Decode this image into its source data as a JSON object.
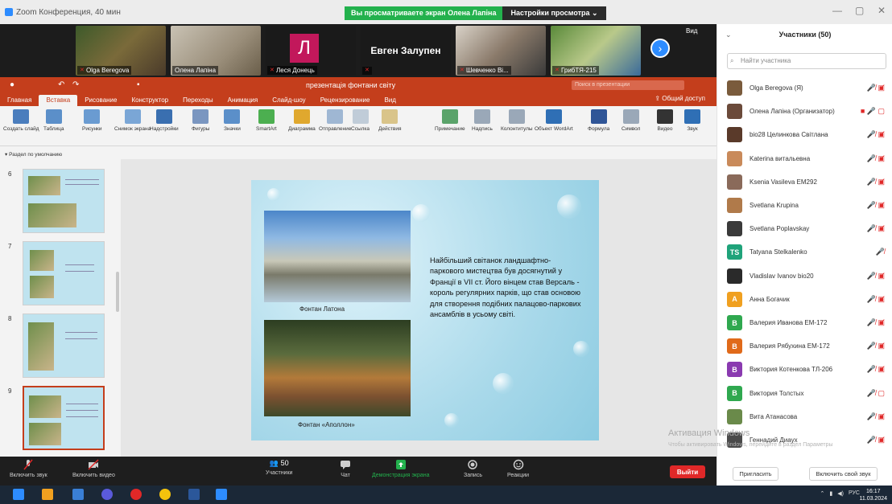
{
  "window": {
    "title": "Zoom Конференция, 40 мин"
  },
  "banner": {
    "viewing": "Вы просматриваете экран Олена Лапіна",
    "options": "Настройки просмотра ⌄"
  },
  "videos": [
    {
      "name": "Olga Beregova"
    },
    {
      "name": "Олена Лапіна"
    },
    {
      "name": "Леся Донець",
      "avatar": "Л"
    },
    {
      "name": "Евген Залупен"
    },
    {
      "name": "Шевченко Ві..."
    },
    {
      "name": "ГрибТЯ-215"
    }
  ],
  "view_label": "Вид",
  "ppt": {
    "doc_title": "презентація фонтани світу",
    "search_placeholder": "Поиск в презентации",
    "tabs": [
      "Главная",
      "Вставка",
      "Рисование",
      "Конструктор",
      "Переходы",
      "Анимация",
      "Слайд-шоу",
      "Рецензирование",
      "Вид"
    ],
    "active_tab": 1,
    "share": "Общий доступ",
    "ribbon": [
      {
        "label": "Создать слайд",
        "color": "#4a7dbd"
      },
      {
        "label": "Таблица",
        "color": "#5b8fc9"
      },
      {
        "label": "Рисунки",
        "color": "#6a9bd1"
      },
      {
        "label": "Снимок экрана",
        "color": "#7aa6d6"
      },
      {
        "label": "Надстройки",
        "color": "#3a6fb0"
      },
      {
        "label": "Фигуры",
        "color": "#7a96c0"
      },
      {
        "label": "Значки",
        "color": "#5b8fc9"
      },
      {
        "label": "SmartArt",
        "color": "#4caf50"
      },
      {
        "label": "Диаграмма",
        "color": "#e0a82e"
      },
      {
        "label": "Отправление",
        "color": "#9fb7d3"
      },
      {
        "label": "Ссылка",
        "color": "#c0ccd8"
      },
      {
        "label": "Действия",
        "color": "#d9c48a"
      },
      {
        "label": "Примечание",
        "color": "#5aa36a"
      },
      {
        "label": "Надпись",
        "color": "#9aa8b8"
      },
      {
        "label": "Колонтитулы",
        "color": "#9aa8b8"
      },
      {
        "label": "Объект WordArt",
        "color": "#2f6fb5"
      },
      {
        "label": "Формула",
        "color": "#2f5597"
      },
      {
        "label": "Символ",
        "color": "#9aa8b8"
      },
      {
        "label": "Видео",
        "color": "#333333"
      },
      {
        "label": "Звук",
        "color": "#2f6fb5"
      }
    ],
    "section": "Раздел по умолчанию",
    "thumbs": [
      "6",
      "7",
      "8",
      "9"
    ],
    "slide": {
      "caption1": "Фонтан Латона",
      "caption2": "Фонтан «Аполлон»",
      "text": "Найбільший світанок ландшафтно-паркового мистецтва був досягнутий у Франції в VII ст. Його вінцем став Версаль - король регулярних парків, що став основою для створення подібних палацово-паркових ансамблів в усьому світі."
    }
  },
  "controls": {
    "audio": "Включить звук",
    "video": "Включить видео",
    "participants": "Участники",
    "participants_count": "50",
    "chat": "Чат",
    "share": "Демонстрация экрана",
    "record": "Запись",
    "reactions": "Реакции",
    "leave": "Выйти"
  },
  "participants_panel": {
    "title": "Участники (50)",
    "search": "Найти участника",
    "invite": "Пригласить",
    "unmute": "Включить свой звук",
    "list": [
      {
        "name": "Olga Beregova (Я)",
        "avatar": "",
        "color": "#7a5b3c",
        "icons": "🎤̸ ▣̸"
      },
      {
        "name": "Олена Лапіна (Организатор)",
        "avatar": "",
        "color": "#6b4a3a",
        "icons": "■ 🎤 ▢"
      },
      {
        "name": "bio28 Целинкова Світлана",
        "avatar": "",
        "color": "#5a3a2a",
        "icons": "🎤̸ ▣̸"
      },
      {
        "name": "Katerina витальевна",
        "avatar": "",
        "color": "#c98a5a",
        "icons": "🎤̸ ▣̸"
      },
      {
        "name": "Ksenia Vasileva ЕМ292",
        "avatar": "",
        "color": "#8a6a5a",
        "icons": "🎤̸ ▣̸"
      },
      {
        "name": "Svetlana Krupina",
        "avatar": "",
        "color": "#b07a4a",
        "icons": "🎤̸ ▣̸"
      },
      {
        "name": "Svetlana Poplavskay",
        "avatar": "",
        "color": "#3a3a3a",
        "icons": "🎤̸ ▣̸"
      },
      {
        "name": "Tatyana Stelkalenko",
        "avatar": "TS",
        "color": "#1fa37a",
        "icons": "🎤̸"
      },
      {
        "name": "Vladislav Ivanov bio20",
        "avatar": "",
        "color": "#2a2a2a",
        "icons": "🎤̸ ▣̸"
      },
      {
        "name": "Анна Богачик",
        "avatar": "A",
        "color": "#f0a020",
        "icons": "🎤̸ ▣̸"
      },
      {
        "name": "Валерия Иванова ЕМ-172",
        "avatar": "B",
        "color": "#2fa84f",
        "icons": "🎤̸ ▣̸"
      },
      {
        "name": "Валерия Рябухина ЕМ-172",
        "avatar": "B",
        "color": "#e06a1a",
        "icons": "🎤̸ ▣̸"
      },
      {
        "name": "Виктория Котенкова ТЛ-206",
        "avatar": "B",
        "color": "#8a3ab0",
        "icons": "🎤̸ ▣̸"
      },
      {
        "name": "Виктория Толстых",
        "avatar": "B",
        "color": "#2fa84f",
        "icons": "🎤̸ ▢"
      },
      {
        "name": "Вита Атанасова",
        "avatar": "",
        "color": "#6a8a4a",
        "icons": "🎤̸ ▣̸"
      },
      {
        "name": "Геннадий Диаух",
        "avatar": "",
        "color": "#4a4a4a",
        "icons": "🎤̸ ▣̸"
      }
    ]
  },
  "watermark": {
    "title": "Активация Windows",
    "sub": "Чтобы активировать Windows, перейдите в раздел Параметры"
  },
  "taskbar": {
    "lang": "РУС",
    "time": "16:17",
    "date": "11.03.2024"
  }
}
